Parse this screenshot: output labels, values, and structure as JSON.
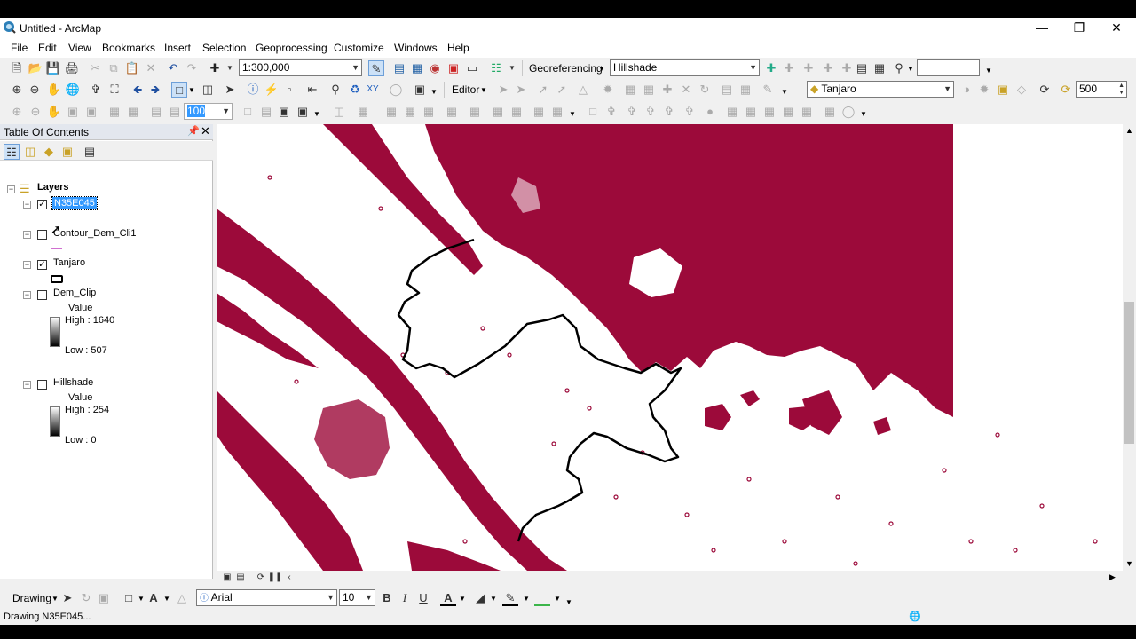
{
  "window": {
    "title": "Untitled - ArcMap"
  },
  "menu": [
    "File",
    "Edit",
    "View",
    "Bookmarks",
    "Insert",
    "Selection",
    "Geoprocessing",
    "Customize",
    "Windows",
    "Help"
  ],
  "toolbar": {
    "scale": "1:300,000",
    "georeferencing_label": "Georeferencing",
    "georef_layer": "Hillshade",
    "editor_label": "Editor",
    "target_layer": "Tanjaro",
    "tolerance_value": "500",
    "opacity_value": "100"
  },
  "toc": {
    "title": "Table Of Contents",
    "root": "Layers",
    "layers": [
      {
        "name": "N35E045",
        "checked": true,
        "selected": true
      },
      {
        "name": "Contour_Dem_Cli1",
        "checked": false,
        "symbol_color": "#d070d0"
      },
      {
        "name": "Tanjaro",
        "checked": true
      },
      {
        "name": "Dem_Clip",
        "checked": false,
        "legend_title": "Value",
        "high": "High : 1640",
        "low": "Low : 507"
      },
      {
        "name": "Hillshade",
        "checked": false,
        "legend_title": "Value",
        "high": "High : 254",
        "low": "Low : 0"
      }
    ]
  },
  "drawing_toolbar": {
    "drawing_label": "Drawing",
    "font": "Arial",
    "font_size": "10",
    "bold": "B",
    "italic": "I",
    "underline": "U",
    "text_tool": "A"
  },
  "status": {
    "text": "Drawing N35E045..."
  },
  "colors": {
    "contour": "#9c0a3a",
    "boundary": "#000000",
    "selection": "#3399ff"
  }
}
